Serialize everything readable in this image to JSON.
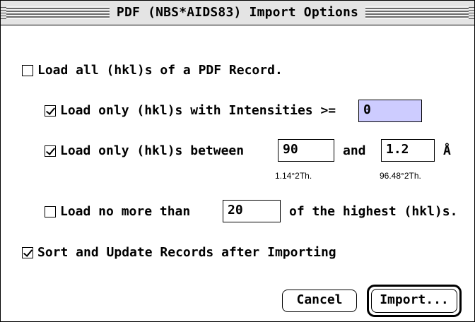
{
  "window": {
    "title": "PDF (NBS*AIDS83) Import Options"
  },
  "options": {
    "load_all": {
      "label": "Load all (hkl)s of a PDF Record.",
      "checked": false
    },
    "intensity": {
      "label": "Load only (hkl)s with Intensities >=",
      "checked": true,
      "value": "0"
    },
    "between": {
      "label": "Load only (hkl)s between",
      "checked": true,
      "value_from": "90",
      "connector": "and",
      "value_to": "1.2",
      "unit": "Å",
      "note_from": "1.14°2Th.",
      "note_to": "96.48°2Th."
    },
    "max_count": {
      "label_before": "Load no more than",
      "checked": false,
      "value": "20",
      "label_after": "of the highest (hkl)s."
    },
    "sort_update": {
      "label": "Sort and Update Records after Importing",
      "checked": true
    }
  },
  "buttons": {
    "cancel": "Cancel",
    "import": "Import..."
  },
  "colors": {
    "active_field": "#cdccff",
    "titlebar": "#e4e4e4"
  }
}
